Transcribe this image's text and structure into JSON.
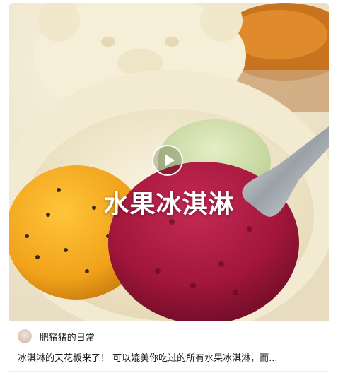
{
  "post": {
    "video_title": "水果冰淇淋",
    "author": "-肥猪猪的日常",
    "description": "冰淇淋的天花板来了！ 可以媲美你吃过的所有水果冰淇淋，而..."
  },
  "icons": {
    "play": "play-icon",
    "avatar": "author-avatar"
  },
  "colors": {
    "mango_scoop": "#f0a21a",
    "berry_scoop": "#a3163b",
    "matcha_scoop": "#cfe0a8",
    "bowl": "#f3ead2"
  }
}
